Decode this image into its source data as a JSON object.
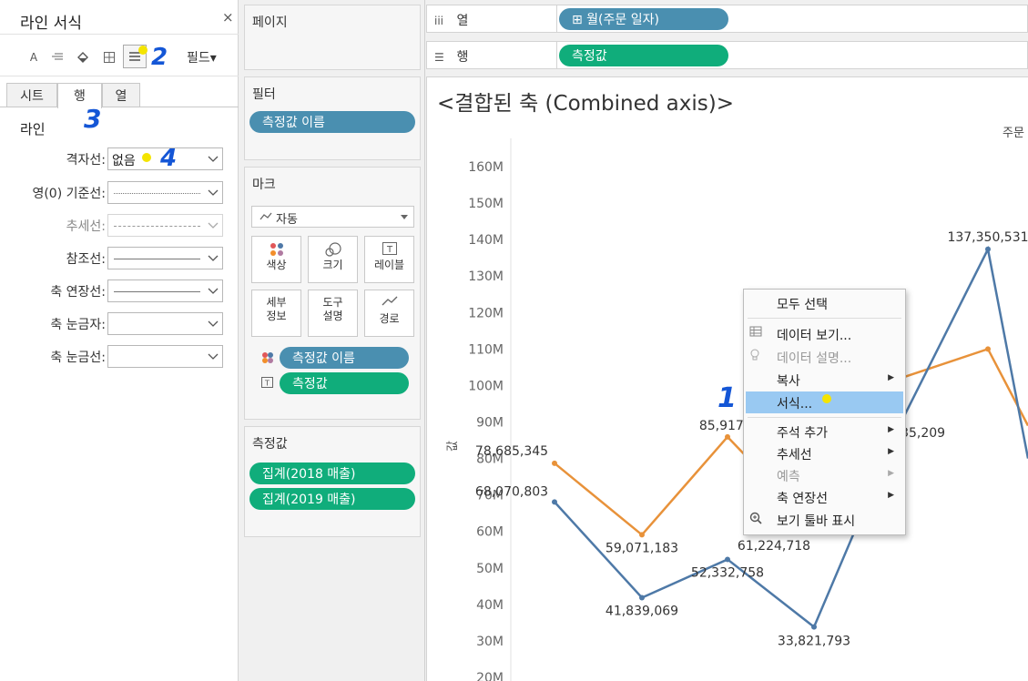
{
  "format_pane": {
    "title": "라인 서식",
    "close": "×",
    "toolbar": {
      "font_icon": "A",
      "align_icon": "≡",
      "shading_icon": "◈",
      "borders_icon": "⊞",
      "lines_icon": "≡",
      "field_label": "필드▾"
    },
    "tabs": [
      "시트",
      "행",
      "열"
    ],
    "active_tab": "행",
    "section": "라인",
    "rows": [
      {
        "label": "격자선:",
        "value": "없음",
        "disabled": false
      },
      {
        "label": "영(0) 기준선:",
        "value": "",
        "line": "dotted",
        "disabled": false
      },
      {
        "label": "추세선:",
        "value": "",
        "line": "dashed",
        "disabled": true
      },
      {
        "label": "참조선:",
        "value": "",
        "line": "solid",
        "disabled": false
      },
      {
        "label": "축 연장선:",
        "value": "",
        "line": "solid",
        "disabled": false
      },
      {
        "label": "축 눈금자:",
        "value": "",
        "line": "none",
        "disabled": false
      },
      {
        "label": "축 눈금선:",
        "value": "",
        "line": "none",
        "disabled": false
      }
    ]
  },
  "cards": {
    "pages": {
      "title": "페이지"
    },
    "filters": {
      "title": "필터",
      "pills": [
        "측정값 이름"
      ]
    },
    "marks": {
      "title": "마크",
      "mark_type": "자동",
      "buttons": [
        {
          "label": "색상",
          "icon": "color-icon"
        },
        {
          "label": "크기",
          "icon": "size-icon"
        },
        {
          "label": "레이블",
          "icon": "label-icon"
        },
        {
          "label": "세부\n정보",
          "l1": "세부",
          "l2": "정보",
          "icon": "detail-icon"
        },
        {
          "label": "도구\n설명",
          "l1": "도구",
          "l2": "설명",
          "icon": "tooltip-icon"
        },
        {
          "label": "경로",
          "icon": "path-icon"
        }
      ],
      "fields": [
        "측정값 이름",
        "측정값"
      ]
    },
    "measure_values": {
      "title": "측정값",
      "pills": [
        "집계(2018 매출)",
        "집계(2019 매출)"
      ]
    }
  },
  "shelves": {
    "columns": {
      "label": "열",
      "icon": "iii",
      "pill": "⊞ 월(주문 일자)"
    },
    "rows": {
      "label": "행",
      "icon": "☰",
      "pill": "측정값"
    }
  },
  "viz": {
    "title": "<결합된 축 (Combined axis)>",
    "header_fragment": "주문",
    "y_axis_title": "값"
  },
  "chart_data": {
    "type": "line",
    "y_ticks": [
      "160M",
      "150M",
      "140M",
      "130M",
      "120M",
      "110M",
      "100M",
      "90M",
      "80M",
      "70M",
      "60M",
      "50M",
      "40M",
      "30M",
      "20M"
    ],
    "ylim": [
      20000000,
      160000000
    ],
    "colors": {
      "series_2018": "#4e79a7",
      "series_2019": "#e8923a"
    },
    "series": [
      {
        "values": [
          68070803,
          41839069,
          52332758,
          33821793,
          89635209,
          137350531,
          80000000
        ],
        "labels": [
          "68,070,803",
          "41,839,069",
          "52,332,758",
          "33,821,793",
          "89,635,209",
          "137,350,531",
          ""
        ]
      },
      {
        "values": [
          78685345,
          59071183,
          85917000,
          61224718,
          102000000,
          110000000,
          89000000
        ],
        "labels": [
          "78,685,345",
          "59,071,183",
          "85,917,0",
          "61,224,718",
          "",
          "",
          ""
        ]
      }
    ]
  },
  "context_menu": {
    "items": [
      {
        "label": "모두 선택",
        "icon": "",
        "disabled": false,
        "submenu": false
      },
      {
        "label": "데이터 보기...",
        "icon": "▦",
        "disabled": false,
        "submenu": false
      },
      {
        "label": "데이터 설명...",
        "icon": "💡",
        "disabled": true,
        "submenu": false
      },
      {
        "label": "복사",
        "icon": "",
        "disabled": false,
        "submenu": true
      },
      {
        "label": "서식...",
        "icon": "",
        "disabled": false,
        "submenu": false,
        "highlighted": true
      },
      {
        "label": "주석 추가",
        "icon": "",
        "disabled": false,
        "submenu": true
      },
      {
        "label": "추세선",
        "icon": "",
        "disabled": false,
        "submenu": true
      },
      {
        "label": "예측",
        "icon": "",
        "disabled": true,
        "submenu": true
      },
      {
        "label": "축 연장선",
        "icon": "",
        "disabled": false,
        "submenu": true
      },
      {
        "label": "보기 툴바 표시",
        "icon": "🔍",
        "disabled": false,
        "submenu": false
      }
    ]
  },
  "annotations": {
    "n1": "1",
    "n2": "2",
    "n3": "3",
    "n4": "4"
  }
}
